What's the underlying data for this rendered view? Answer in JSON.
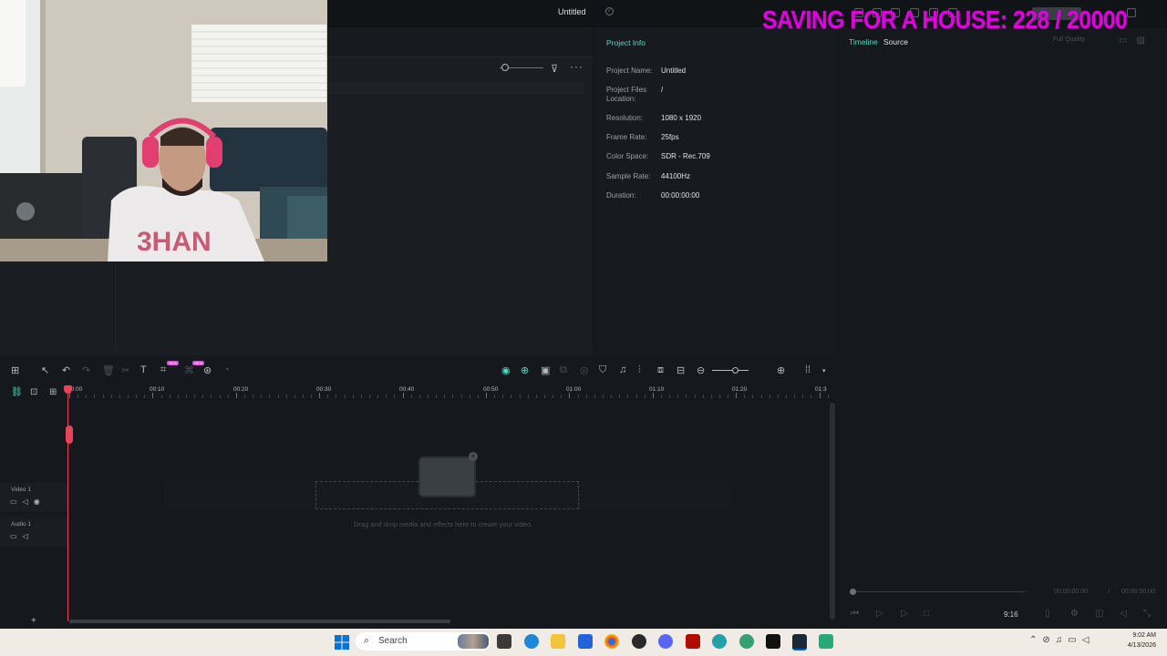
{
  "app": {
    "title": "Untitled"
  },
  "overlay": {
    "text": "SAVING FOR A HOUSE: 228 / 20000",
    "color": "#e100e1"
  },
  "project_info": {
    "title": "Project Info",
    "rows": [
      {
        "label": "Project Name:",
        "value": "Untitled"
      },
      {
        "label": "Project Files Location:",
        "value": "/"
      },
      {
        "label": "Resolution:",
        "value": "1080 x 1920"
      },
      {
        "label": "Frame Rate:",
        "value": "25fps"
      },
      {
        "label": "Color Space:",
        "value": "SDR - Rec.709"
      },
      {
        "label": "Sample Rate:",
        "value": "44100Hz"
      },
      {
        "label": "Duration:",
        "value": "00:00:00:00"
      }
    ]
  },
  "preview": {
    "tabs": [
      "Timeline",
      "Source"
    ],
    "quality": "Full Quality",
    "time_current": "00:00:00:00",
    "time_sep": "/",
    "time_total": "00:00:00:00",
    "aspect_ratio": "9:16"
  },
  "timeline": {
    "ruler": [
      "00:00",
      "00:10",
      "00:20",
      "00:30",
      "00:40",
      "00:50",
      "01:00",
      "01:10",
      "01:20",
      "01:3"
    ],
    "tracks": [
      {
        "name": "Video 1"
      },
      {
        "name": "Audio 1"
      }
    ],
    "drop_hint": "Drag and drop media and effects here to create your video.",
    "accent": "#4fdcc4",
    "playhead_color": "#e8435a"
  },
  "taskbar": {
    "search_label": "Search",
    "clock_time": "9:02 AM",
    "clock_date": "4/13/2026"
  },
  "icons": [
    "checkmark-icon",
    "filter-icon",
    "more-icon",
    "undo-icon",
    "redo-icon",
    "delete-icon",
    "cut-icon",
    "text-icon",
    "plus-icon",
    "search-icon",
    "windows-start-icon"
  ]
}
